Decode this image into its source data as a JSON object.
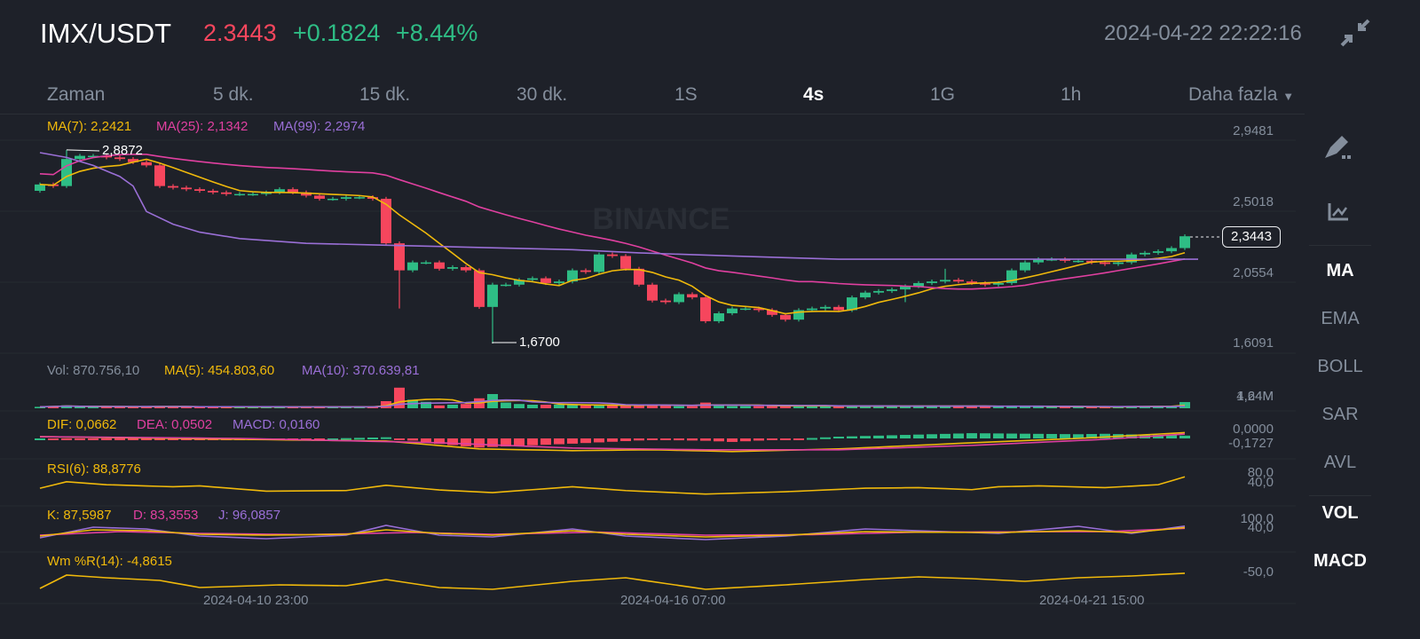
{
  "header": {
    "symbol": "IMX/USDT",
    "last": "2.3443",
    "change": "+0.1824",
    "percent": "+8.44%",
    "datetime": "2024-04-22 22:22:16"
  },
  "tabs": [
    "Zaman",
    "5 dk.",
    "15 dk.",
    "30 dk.",
    "1S",
    "4s",
    "1G",
    "1h",
    "Daha fazla"
  ],
  "active_tab": "4s",
  "sidebar": {
    "items": [
      "MA",
      "EMA",
      "BOLL",
      "SAR",
      "AVL",
      "VOL",
      "MACD"
    ]
  },
  "colors": {
    "up": "#2ebd85",
    "down": "#f6465d",
    "ma7": "#f0b90b",
    "ma25": "#e040a0",
    "ma99": "#9a6fd6",
    "bg": "#1e2129"
  },
  "legends": {
    "ma7": "MA(7): 2,2421",
    "ma25": "MA(25): 2,1342",
    "ma99": "MA(99): 2,2974",
    "vol": "Vol: 870.756,10",
    "vol_ma5": "MA(5): 454.803,60",
    "vol_ma10": "MA(10): 370.639,81",
    "dif": "DIF: 0,0662",
    "dea": "DEA: 0,0502",
    "macd": "MACD: 0,0160",
    "rsi": "RSI(6): 88,8776",
    "k": "K: 87,5987",
    "d": "D: 83,3553",
    "j": "J: 96,0857",
    "wr": "Wm %R(14): -4,8615"
  },
  "axes": {
    "price": [
      "2,9481",
      "2,5018",
      "2,0554",
      "1,6091"
    ],
    "vol": [
      "4,24M",
      "1,64M"
    ],
    "macd": [
      "0,0000",
      "-0,1727"
    ],
    "rsi": [
      "80,0",
      "40,0"
    ],
    "kdj": [
      "100,0",
      "40,0"
    ],
    "wr": [
      "-50,0"
    ],
    "time": [
      "2024-04-10 23:00",
      "2024-04-16 07:00",
      "2024-04-21 15:00"
    ]
  },
  "annotations": {
    "high": "2,8872",
    "low": "1,6700",
    "current": "2,3443"
  },
  "watermark": "BINANCE",
  "chart_data": {
    "type": "candlestick",
    "price_range": [
      1.6091,
      2.9481
    ],
    "closes": [
      2.67,
      2.66,
      2.83,
      2.85,
      2.85,
      2.84,
      2.83,
      2.81,
      2.79,
      2.66,
      2.65,
      2.64,
      2.63,
      2.62,
      2.61,
      2.61,
      2.61,
      2.62,
      2.64,
      2.62,
      2.6,
      2.58,
      2.58,
      2.59,
      2.59,
      2.58,
      2.3,
      2.13,
      2.18,
      2.18,
      2.14,
      2.15,
      2.13,
      1.9,
      2.04,
      2.04,
      2.07,
      2.08,
      2.05,
      2.06,
      2.13,
      2.12,
      2.23,
      2.22,
      2.14,
      2.04,
      1.94,
      1.93,
      1.98,
      1.96,
      1.81,
      1.86,
      1.89,
      1.89,
      1.88,
      1.85,
      1.82,
      1.88,
      1.89,
      1.9,
      1.88,
      1.96,
      1.99,
      2.0,
      2.01,
      2.03,
      2.05,
      2.06,
      2.07,
      2.06,
      2.05,
      2.04,
      2.05,
      2.13,
      2.18,
      2.2,
      2.2,
      2.19,
      2.19,
      2.18,
      2.17,
      2.18,
      2.23,
      2.24,
      2.25,
      2.27,
      2.3443
    ],
    "first_open": 2.63,
    "extreme_wicks": {
      "2": {
        "high": 2.8872
      },
      "27": {
        "low": 1.89
      },
      "34": {
        "low": 1.67
      },
      "65": {
        "low": 1.93
      },
      "68": {
        "high": 2.14
      }
    },
    "ma99": [
      [
        0,
        2.87
      ],
      [
        20,
        2.84
      ],
      [
        40,
        2.79
      ],
      [
        60,
        2.72
      ],
      [
        70,
        2.66
      ],
      [
        80,
        2.5
      ],
      [
        100,
        2.42
      ],
      [
        120,
        2.37
      ],
      [
        150,
        2.33
      ],
      [
        200,
        2.3
      ],
      [
        250,
        2.29
      ],
      [
        300,
        2.28
      ],
      [
        350,
        2.27
      ],
      [
        400,
        2.26
      ],
      [
        450,
        2.24
      ],
      [
        520,
        2.22
      ],
      [
        560,
        2.21
      ],
      [
        600,
        2.2
      ],
      [
        640,
        2.2
      ],
      [
        680,
        2.2
      ],
      [
        720,
        2.2
      ],
      [
        760,
        2.2
      ],
      [
        800,
        2.2
      ],
      [
        840,
        2.2
      ],
      [
        870,
        2.2
      ]
    ],
    "volume_m": [
      0.2,
      0.3,
      0.4,
      0.2,
      0.2,
      0.2,
      0.2,
      0.3,
      0.2,
      0.3,
      0.2,
      0.2,
      0.2,
      0.2,
      0.2,
      0.2,
      0.2,
      0.2,
      0.2,
      0.2,
      0.2,
      0.2,
      0.2,
      0.2,
      0.2,
      0.2,
      1.0,
      2.9,
      1.2,
      0.9,
      0.4,
      0.5,
      0.6,
      1.4,
      2.0,
      0.8,
      0.6,
      0.5,
      0.5,
      0.5,
      0.5,
      0.4,
      0.4,
      0.4,
      0.4,
      0.5,
      0.5,
      0.4,
      0.3,
      0.3,
      0.8,
      0.5,
      0.3,
      0.3,
      0.3,
      0.4,
      0.4,
      0.3,
      0.3,
      0.3,
      0.3,
      0.3,
      0.3,
      0.3,
      0.3,
      0.3,
      0.3,
      0.3,
      0.3,
      0.3,
      0.3,
      0.3,
      0.2,
      0.3,
      0.3,
      0.3,
      0.2,
      0.2,
      0.2,
      0.2,
      0.2,
      0.2,
      0.3,
      0.3,
      0.3,
      0.3,
      0.87
    ],
    "dif": [
      [
        0,
        0.02
      ],
      [
        10,
        0.0
      ],
      [
        20,
        -0.02
      ],
      [
        26,
        -0.03
      ],
      [
        33,
        -0.12
      ],
      [
        40,
        -0.14
      ],
      [
        46,
        -0.13
      ],
      [
        52,
        -0.15
      ],
      [
        60,
        -0.12
      ],
      [
        70,
        -0.05
      ],
      [
        78,
        0.0
      ],
      [
        86,
        0.0662
      ]
    ],
    "dea": [
      [
        0,
        0.02
      ],
      [
        15,
        0.0
      ],
      [
        30,
        -0.05
      ],
      [
        40,
        -0.11
      ],
      [
        50,
        -0.13
      ],
      [
        60,
        -0.13
      ],
      [
        70,
        -0.08
      ],
      [
        80,
        -0.01
      ],
      [
        86,
        0.0502
      ]
    ],
    "rsi": [
      [
        0,
        50
      ],
      [
        2,
        72
      ],
      [
        5,
        62
      ],
      [
        10,
        55
      ],
      [
        12,
        58
      ],
      [
        17,
        40
      ],
      [
        23,
        42
      ],
      [
        26,
        60
      ],
      [
        30,
        44
      ],
      [
        34,
        35
      ],
      [
        40,
        55
      ],
      [
        44,
        42
      ],
      [
        50,
        30
      ],
      [
        56,
        38
      ],
      [
        62,
        50
      ],
      [
        66,
        52
      ],
      [
        70,
        45
      ],
      [
        72,
        55
      ],
      [
        75,
        58
      ],
      [
        80,
        52
      ],
      [
        84,
        62
      ],
      [
        86,
        88.8776
      ]
    ],
    "k": [
      [
        0,
        40
      ],
      [
        4,
        75
      ],
      [
        8,
        70
      ],
      [
        12,
        50
      ],
      [
        17,
        45
      ],
      [
        23,
        50
      ],
      [
        26,
        75
      ],
      [
        30,
        55
      ],
      [
        34,
        45
      ],
      [
        40,
        70
      ],
      [
        44,
        50
      ],
      [
        50,
        35
      ],
      [
        56,
        45
      ],
      [
        62,
        65
      ],
      [
        66,
        62
      ],
      [
        72,
        60
      ],
      [
        78,
        70
      ],
      [
        82,
        60
      ],
      [
        86,
        87.5987
      ]
    ],
    "d": [
      [
        0,
        45
      ],
      [
        6,
        65
      ],
      [
        12,
        55
      ],
      [
        20,
        48
      ],
      [
        28,
        60
      ],
      [
        34,
        50
      ],
      [
        42,
        62
      ],
      [
        50,
        45
      ],
      [
        58,
        48
      ],
      [
        66,
        62
      ],
      [
        74,
        64
      ],
      [
        80,
        65
      ],
      [
        86,
        83.3553
      ]
    ],
    "j": [
      [
        0,
        30
      ],
      [
        4,
        90
      ],
      [
        8,
        80
      ],
      [
        12,
        40
      ],
      [
        17,
        25
      ],
      [
        23,
        45
      ],
      [
        26,
        100
      ],
      [
        30,
        45
      ],
      [
        34,
        35
      ],
      [
        40,
        80
      ],
      [
        44,
        40
      ],
      [
        50,
        20
      ],
      [
        56,
        40
      ],
      [
        62,
        80
      ],
      [
        66,
        70
      ],
      [
        72,
        55
      ],
      [
        78,
        95
      ],
      [
        82,
        55
      ],
      [
        86,
        96.0857
      ]
    ],
    "wr": [
      [
        0,
        -90
      ],
      [
        2,
        -15
      ],
      [
        5,
        -30
      ],
      [
        9,
        -45
      ],
      [
        12,
        -85
      ],
      [
        18,
        -70
      ],
      [
        23,
        -75
      ],
      [
        26,
        -40
      ],
      [
        30,
        -85
      ],
      [
        34,
        -95
      ],
      [
        40,
        -50
      ],
      [
        44,
        -30
      ],
      [
        50,
        -95
      ],
      [
        56,
        -70
      ],
      [
        62,
        -40
      ],
      [
        66,
        -25
      ],
      [
        70,
        -35
      ],
      [
        74,
        -50
      ],
      [
        78,
        -30
      ],
      [
        82,
        -20
      ],
      [
        86,
        -4.8615
      ]
    ]
  }
}
